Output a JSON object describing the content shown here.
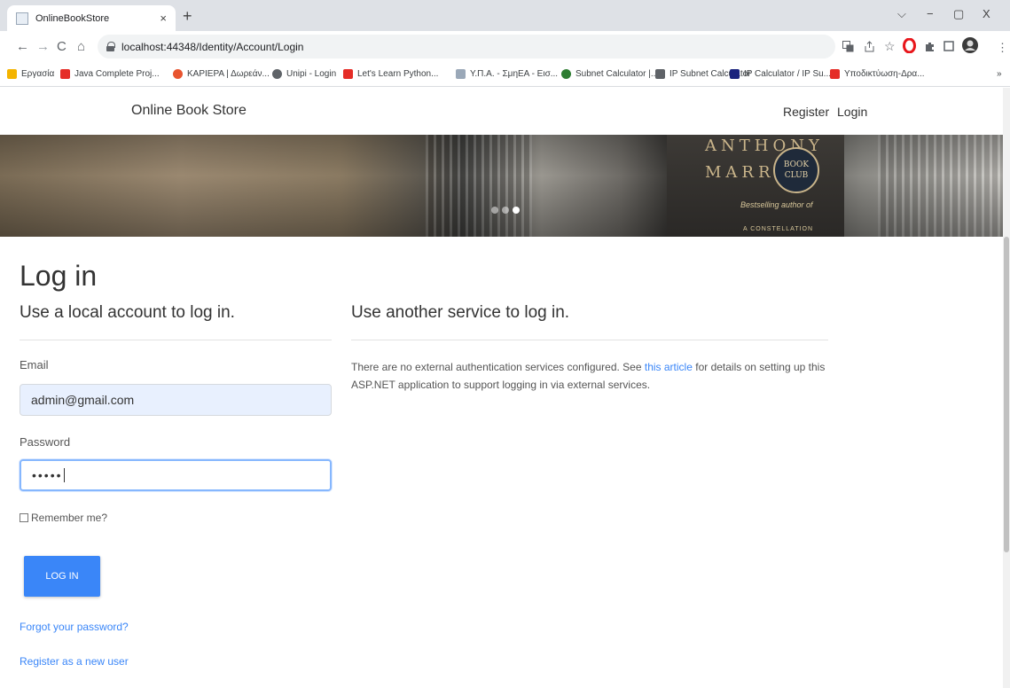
{
  "browser": {
    "tab_title": "OnlineBookStore",
    "tab_close": "×",
    "new_tab": "+",
    "url": "localhost:44348/Identity/Account/Login",
    "back": "←",
    "forward": "→",
    "reload": "C",
    "home": "⌂",
    "window_minimize": "−",
    "window_restore": "▢",
    "window_close": "X",
    "tab_search": "⌵",
    "bookmarks_overflow": "»"
  },
  "bookmarks": [
    {
      "label": "Εργασία",
      "color": "#f4b400"
    },
    {
      "label": "Java Complete Proj...",
      "color": "#e52d27"
    },
    {
      "label": "ΚΑΡΙΕΡΑ | Δωρεάν...",
      "color": "#e8542f"
    },
    {
      "label": "Unipi - Login",
      "color": "#5f6368"
    },
    {
      "label": "Let's Learn Python...",
      "color": "#e52d27"
    },
    {
      "label": "Υ.Π.Α. - ΣμηΕΑ - Εισ...",
      "color": "#9aa8b8"
    },
    {
      "label": "Subnet Calculator |...",
      "color": "#2e7d32"
    },
    {
      "label": "IP Subnet Calculator",
      "color": "#5f6368"
    },
    {
      "label": "IP Calculator / IP Su...",
      "color": "#1a237e"
    },
    {
      "label": "Υποδικτύωση-Δρα...",
      "color": "#e52d27"
    }
  ],
  "header": {
    "brand": "Online Book Store",
    "register": "Register",
    "login": "Login"
  },
  "banner": {
    "author": "ANTHONY",
    "author_2": "MARRA",
    "seal_1": "BOOK",
    "seal_2": "CLUB",
    "subtitle": "Bestselling author of",
    "footer": "A CONSTELLATION",
    "slides": 3,
    "active_slide": 3
  },
  "page": {
    "title": "Log in",
    "local_heading": "Use a local account to log in.",
    "external_heading": "Use another service to log in.",
    "email_label": "Email",
    "email_value": "admin@gmail.com",
    "password_label": "Password",
    "password_value": "•••••",
    "remember_label": "Remember me?",
    "login_button": "LOG IN",
    "forgot_link": "Forgot your password?",
    "register_link": "Register as a new user",
    "external_text_1": "There are no external authentication services configured. See ",
    "external_link": "this article",
    "external_text_2": " for details on setting up this ASP.NET application to support logging in via external services."
  },
  "colors": {
    "accent": "#3a86f8",
    "autofill": "#e8f0fe",
    "focus": "#86b7fe"
  }
}
